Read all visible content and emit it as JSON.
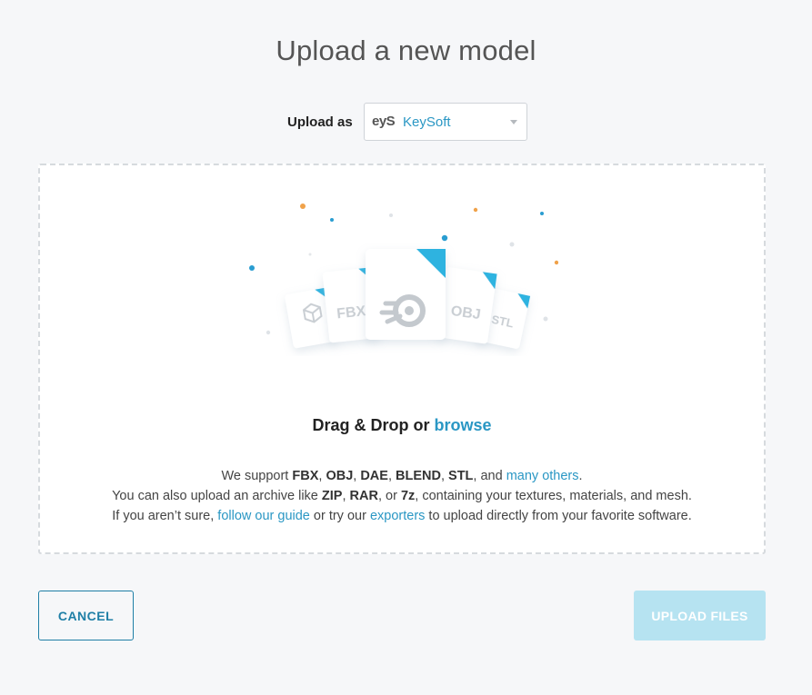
{
  "page": {
    "title": "Upload a new model"
  },
  "upload_as": {
    "label": "Upload as",
    "selected_value": "KeySoft",
    "logo_text": "eyS"
  },
  "dropzone": {
    "drag_drop_text": "Drag & Drop or ",
    "browse_link": "browse",
    "file_cards": [
      "FBX",
      "OBJ",
      "STL"
    ],
    "support_line": {
      "prefix": "We support ",
      "formats": [
        "FBX",
        "OBJ",
        "DAE",
        "BLEND",
        "STL"
      ],
      "and_text": ", and ",
      "many_others_link": "many others",
      "suffix": "."
    },
    "archive_line": {
      "prefix": "You can also upload an archive like ",
      "archives": [
        "ZIP",
        "RAR",
        "7z"
      ],
      "suffix": ", containing your textures, materials, and mesh."
    },
    "guide_line": {
      "prefix": "If you aren’t sure, ",
      "guide_link": "follow our guide",
      "middle": " or try our ",
      "exporters_link": "exporters",
      "suffix": " to upload directly from your favorite software."
    }
  },
  "actions": {
    "cancel_label": "CANCEL",
    "upload_label": "UPLOAD FILES"
  },
  "colors": {
    "accent": "#2a97c4",
    "button_border": "#1f7fa6",
    "upload_disabled_bg": "#b6e3f1",
    "dot_orange": "#f0a24a",
    "dot_blue": "#2a9dd1"
  }
}
